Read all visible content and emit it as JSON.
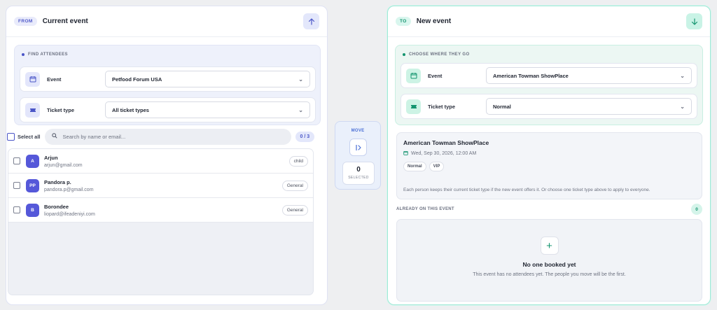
{
  "left_panel": {
    "tag": "FROM",
    "title": "Current event",
    "finder": {
      "title": "FIND ATTENDEES",
      "event_label": "Event",
      "event_value": "Petfood Forum USA",
      "ticket_label": "Ticket type",
      "ticket_value": "All ticket types"
    },
    "select_all_label": "Select all",
    "search_placeholder": "Search by name or email...",
    "count": "0 / 3",
    "attendees": [
      {
        "initials": "A",
        "name": "Arjun",
        "email": "arjun@gmail.com",
        "ticket": "child"
      },
      {
        "initials": "PP",
        "name": "Pandora p.",
        "email": "pandora.p@gmail.com",
        "ticket": "General"
      },
      {
        "initials": "B",
        "name": "Borondee",
        "email": "liopard@ifeadeniyi.com",
        "ticket": "General"
      }
    ]
  },
  "move": {
    "label": "MOVE",
    "selected_count": "0",
    "selected_label": "SELECTED"
  },
  "right_panel": {
    "tag": "TO",
    "title": "New event",
    "finder": {
      "title": "CHOOSE WHERE THEY GO",
      "event_label": "Event",
      "event_value": "American Towman ShowPlace",
      "ticket_label": "Ticket type",
      "ticket_value": "Normal"
    },
    "detail": {
      "name": "American Towman ShowPlace",
      "date": "Wed, Sep 30, 2026, 12:00 AM",
      "chips": [
        "Normal",
        "VIP"
      ],
      "note": "Each person keeps their current ticket type if the new event offers it. Or choose one ticket type above to apply to everyone."
    },
    "already_label": "ALREADY ON THIS EVENT",
    "already_count": "0",
    "empty_title": "No one booked yet",
    "empty_subtitle": "This event has no attendees yet. The people you move will be the first."
  },
  "colors": {
    "from_accent": "#4a55c7",
    "to_accent": "#14946f",
    "avatar": "#5558d9"
  },
  "icons": {
    "from_header": "arrow-up-icon",
    "to_header": "arrow-down-icon",
    "event": "calendar-icon",
    "ticket": "ticket-icon",
    "search": "search-icon",
    "move": "move-arrow-icon",
    "empty": "plus-icon"
  }
}
